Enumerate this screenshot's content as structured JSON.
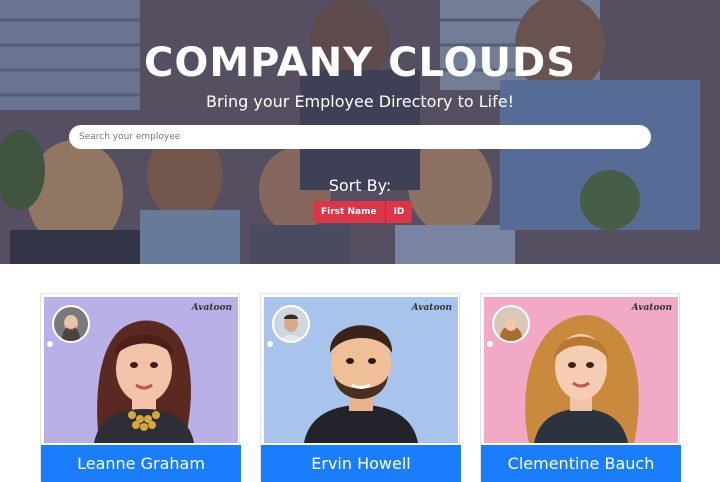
{
  "header": {
    "title": "COMPANY CLOUDS",
    "subtitle": "Bring your Employee Directory to Life!"
  },
  "search": {
    "placeholder": "Search your employee",
    "value": ""
  },
  "sort": {
    "label": "Sort By:",
    "options": [
      "First Name",
      "ID"
    ]
  },
  "employees": [
    {
      "name": "Leanne Graham",
      "brand": "Avatoon",
      "bg": "#b9b0e8"
    },
    {
      "name": "Ervin Howell",
      "brand": "Avatoon",
      "bg": "#a9c4ec"
    },
    {
      "name": "Clementine Bauch",
      "brand": "Avatoon",
      "bg": "#f2a9c6"
    }
  ],
  "colors": {
    "accent": "#1a7efc",
    "sort_button": "#dc3545"
  }
}
